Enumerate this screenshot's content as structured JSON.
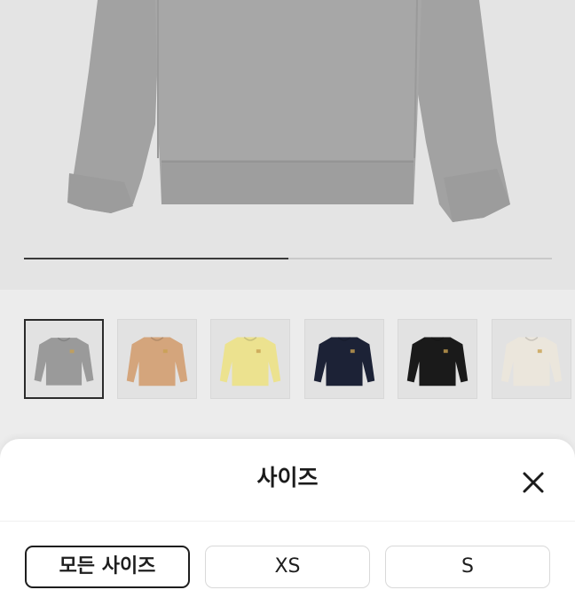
{
  "gallery": {
    "progress": 0.5,
    "thumbnails": [
      {
        "color": "#9a9a9a",
        "name": "grey"
      },
      {
        "color": "#d4a57c",
        "name": "beige"
      },
      {
        "color": "#ece28f",
        "name": "yellow"
      },
      {
        "color": "#1c2236",
        "name": "navy"
      },
      {
        "color": "#1a1a1a",
        "name": "black"
      },
      {
        "color": "#ebe6dc",
        "name": "ecru"
      }
    ]
  },
  "sheet": {
    "title": "사이즈",
    "close_icon": "close-icon",
    "options": [
      "모든 사이즈",
      "XS",
      "S"
    ]
  }
}
